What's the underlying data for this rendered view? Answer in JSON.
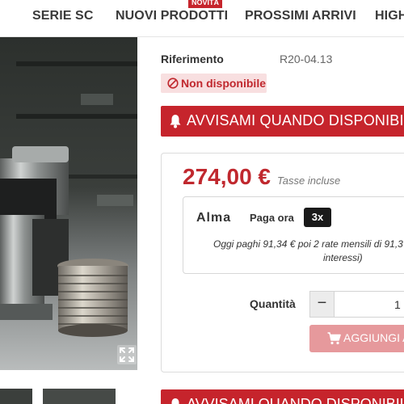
{
  "nav": {
    "items": [
      "SERIE SC",
      "NUOVI PRODOTTI",
      "PROSSIMI ARRIVI",
      "HIGH"
    ],
    "new_badge": "NOVITÀ"
  },
  "product": {
    "reference_label": "Riferimento",
    "reference_value": "R20-04.13",
    "availability": "Non disponibile",
    "notify_label": "AVVISAMI QUANDO DISPONIBILE",
    "price": "274,00 €",
    "tax_note": "Tasse incluse"
  },
  "alma": {
    "logo": "Alma",
    "pay_now": "Paga ora",
    "installments": "3x",
    "description_line1": "Oggi paghi 91,34 € poi 2 rate mensili di 91,3",
    "description_line2": "interessi)"
  },
  "quantity": {
    "label": "Quantità",
    "minus": "−",
    "value": "1"
  },
  "cart": {
    "add_label": "AGGIUNGI A"
  },
  "colors": {
    "accent_red": "#c6242c",
    "unavailable_bg": "#f8dfe0",
    "disabled_add": "#e6999c"
  },
  "icons": [
    "ban-icon",
    "bell-icon",
    "cart-icon",
    "expand-icon"
  ]
}
